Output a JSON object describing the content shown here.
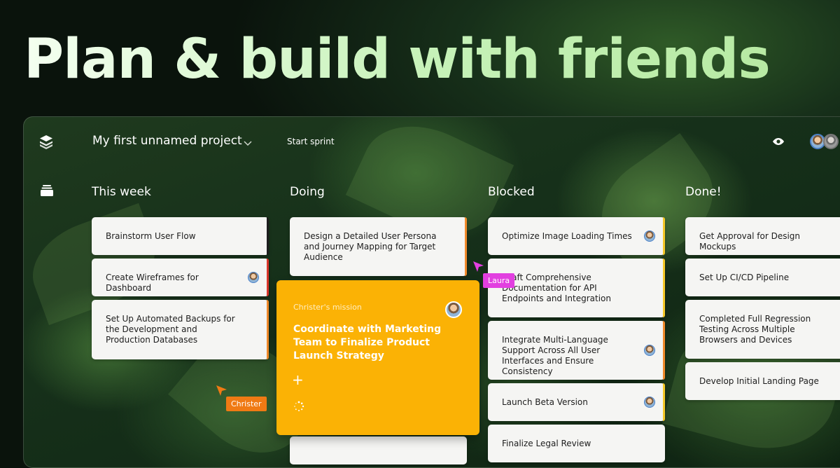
{
  "headline": "Plan & build with friends",
  "project": {
    "title": "My first unnamed project",
    "start_sprint_label": "Start sprint"
  },
  "icons": {
    "logo": "layers-logo-icon",
    "sidebar": "inbox-stack-icon",
    "dropdown": "chevron-down-icon",
    "visibility": "eye-icon",
    "add": "plus-icon",
    "loading": "spinner-icon"
  },
  "colors": {
    "accent_orange": "#fbb205",
    "cursor_laura": "#e23fe0",
    "cursor_christer": "#f07a14",
    "stripe_red": "#d9362b",
    "stripe_orange": "#f08a2b",
    "stripe_yellow": "#f5c829"
  },
  "columns": [
    {
      "title": "This week",
      "cards": [
        {
          "text": "Brainstorm User Flow"
        },
        {
          "text": "Create Wireframes for Dashboard"
        },
        {
          "text": "Set Up Automated Backups for the Development and Production Databases"
        }
      ]
    },
    {
      "title": "Doing",
      "cards": [
        {
          "text": "Design a Detailed User Persona and Journey Mapping for Target Audience"
        }
      ],
      "focus_card": {
        "label": "Christer's mission",
        "title": "Coordinate with Marketing Team to Finalize Product Launch Strategy"
      }
    },
    {
      "title": "Blocked",
      "cards": [
        {
          "text": "Optimize Image Loading Times"
        },
        {
          "text": "Draft Comprehensive Documentation for API Endpoints and Integration"
        },
        {
          "text": "Integrate Multi-Language Support Across All User Interfaces and Ensure Consistency"
        },
        {
          "text": "Launch Beta Version"
        },
        {
          "text": "Finalize Legal Review"
        }
      ]
    },
    {
      "title": "Done!",
      "cards": [
        {
          "text": "Get Approval for Design Mockups"
        },
        {
          "text": "Set Up CI/CD Pipeline"
        },
        {
          "text": "Completed Full Regression Testing Across Multiple Browsers and Devices"
        },
        {
          "text": "Develop Initial Landing Page"
        }
      ]
    }
  ],
  "cursors": {
    "laura": "Laura",
    "christer": "Christer"
  }
}
